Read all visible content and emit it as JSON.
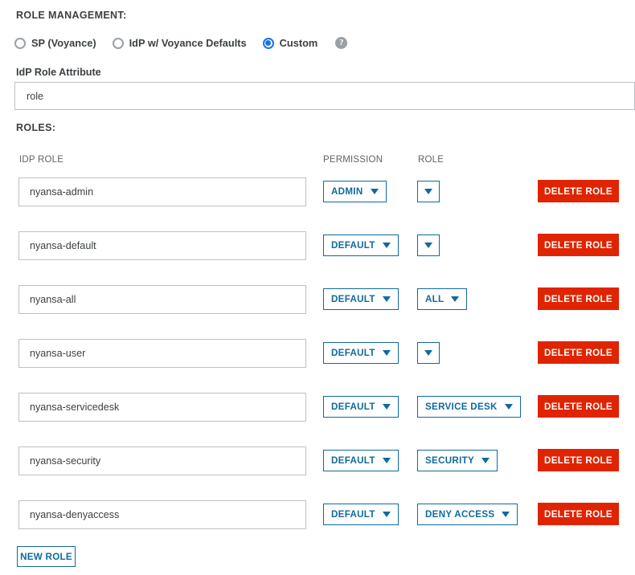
{
  "section": {
    "role_management_heading": "ROLE MANAGEMENT:",
    "roles_heading": "ROLES:"
  },
  "mode_radio": {
    "options": [
      {
        "label": "SP (Voyance)",
        "selected": false
      },
      {
        "label": "IdP w/ Voyance Defaults",
        "selected": false
      },
      {
        "label": "Custom",
        "selected": true
      }
    ],
    "help_icon": "?"
  },
  "idp_attribute": {
    "label": "IdP Role Attribute",
    "value": "role",
    "placeholder": ""
  },
  "table": {
    "columns": [
      "IDP ROLE",
      "PERMISSION",
      "ROLE"
    ],
    "rows": [
      {
        "idp_role": "nyansa-admin",
        "permission": "ADMIN",
        "role": ""
      },
      {
        "idp_role": "nyansa-default",
        "permission": "DEFAULT",
        "role": ""
      },
      {
        "idp_role": "nyansa-all",
        "permission": "DEFAULT",
        "role": "ALL"
      },
      {
        "idp_role": "nyansa-user",
        "permission": "DEFAULT",
        "role": ""
      },
      {
        "idp_role": "nyansa-servicedesk",
        "permission": "DEFAULT",
        "role": "SERVICE DESK"
      },
      {
        "idp_role": "nyansa-security",
        "permission": "DEFAULT",
        "role": "SECURITY"
      },
      {
        "idp_role": "nyansa-denyaccess",
        "permission": "DEFAULT",
        "role": "DENY ACCESS"
      }
    ],
    "delete_label": "DELETE ROLE"
  },
  "actions": {
    "new_role_label": "NEW ROLE"
  },
  "colors": {
    "accent_blue": "#0f6a9e",
    "radio_blue": "#1a73e8",
    "danger_red": "#e02401",
    "border_gray": "#bdc1c6",
    "text_gray": "#3c4043"
  },
  "layout": {
    "row_top_start": 221,
    "row_pitch": 67
  }
}
